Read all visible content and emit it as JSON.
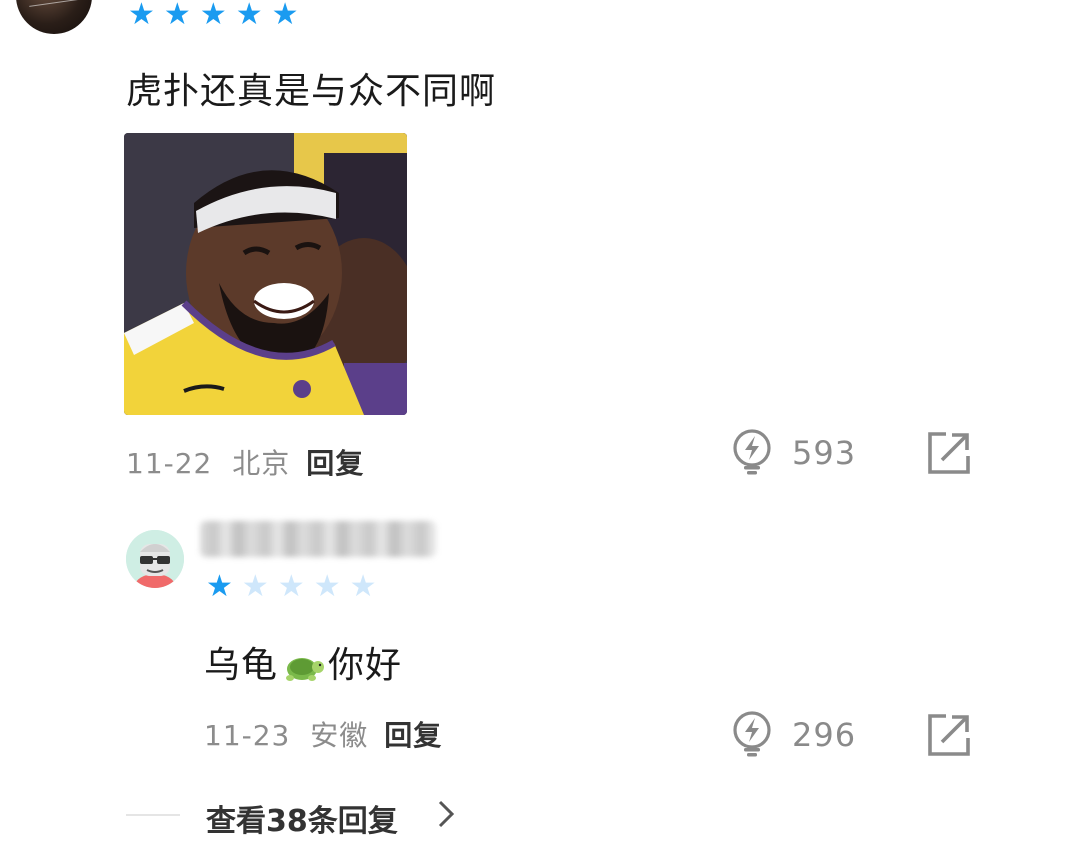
{
  "comments": [
    {
      "rating": 5,
      "text": "虎扑还真是与众不同啊",
      "date": "11-22",
      "location": "北京",
      "reply_label": "回复",
      "likes": "593"
    },
    {
      "rating": 1,
      "text_before": "乌龟",
      "text_after": "你好",
      "date": "11-23",
      "location": "安徽",
      "reply_label": "回复",
      "likes": "296"
    }
  ],
  "view_replies": "查看38条回复",
  "icons": {
    "star": "star-icon",
    "like": "lightning-bulb-icon",
    "share": "share-icon",
    "chevron": "chevron-right-icon",
    "turtle": "turtle-emoji-icon"
  },
  "colors": {
    "star_active": "#1a9bf0",
    "star_inactive": "#cfe7fb",
    "meta_text": "#8c8c8c",
    "icon_gray": "#8a8a8a"
  }
}
